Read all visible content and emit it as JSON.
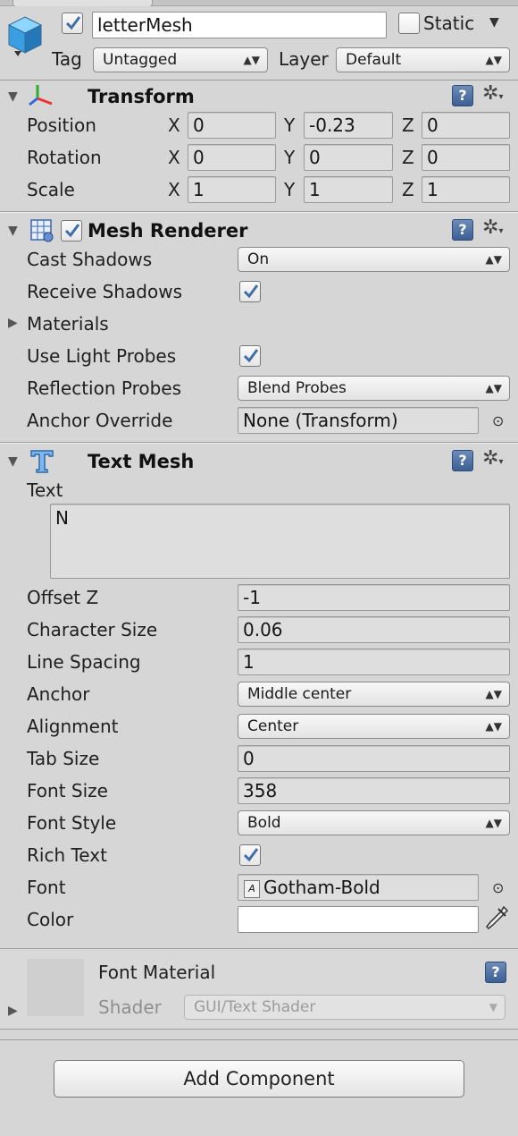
{
  "header": {
    "object_name": "letterMesh",
    "static_label": "Static",
    "tag_label": "Tag",
    "tag_value": "Untagged",
    "layer_label": "Layer",
    "layer_value": "Default"
  },
  "transform": {
    "title": "Transform",
    "position_label": "Position",
    "rotation_label": "Rotation",
    "scale_label": "Scale",
    "axis_x": "X",
    "axis_y": "Y",
    "axis_z": "Z",
    "position": {
      "x": "0",
      "y": "-0.23",
      "z": "0"
    },
    "rotation": {
      "x": "0",
      "y": "0",
      "z": "0"
    },
    "scale": {
      "x": "1",
      "y": "1",
      "z": "1"
    }
  },
  "mesh_renderer": {
    "title": "Mesh Renderer",
    "cast_shadows_label": "Cast Shadows",
    "cast_shadows_value": "On",
    "receive_shadows_label": "Receive Shadows",
    "materials_label": "Materials",
    "use_light_probes_label": "Use Light Probes",
    "reflection_probes_label": "Reflection Probes",
    "reflection_probes_value": "Blend Probes",
    "anchor_override_label": "Anchor Override",
    "anchor_override_value": "None (Transform)"
  },
  "text_mesh": {
    "title": "Text Mesh",
    "text_label": "Text",
    "text_value": "N",
    "offset_z_label": "Offset Z",
    "offset_z_value": "-1",
    "character_size_label": "Character Size",
    "character_size_value": "0.06",
    "line_spacing_label": "Line Spacing",
    "line_spacing_value": "1",
    "anchor_label": "Anchor",
    "anchor_value": "Middle center",
    "alignment_label": "Alignment",
    "alignment_value": "Center",
    "tab_size_label": "Tab Size",
    "tab_size_value": "0",
    "font_size_label": "Font Size",
    "font_size_value": "358",
    "font_style_label": "Font Style",
    "font_style_value": "Bold",
    "rich_text_label": "Rich Text",
    "font_label": "Font",
    "font_value": "Gotham-Bold",
    "color_label": "Color",
    "color_value": "#ffffff"
  },
  "font_material": {
    "title": "Font Material",
    "shader_label": "Shader",
    "shader_value": "GUI/Text Shader"
  },
  "footer": {
    "add_component_label": "Add Component"
  },
  "icons": {
    "object": "cube-icon",
    "transform": "transform-axes-icon",
    "mesh_renderer": "mesh-renderer-icon",
    "text_mesh": "text-mesh-icon",
    "help": "help-book-icon",
    "settings": "gear-icon",
    "object_picker": "object-picker-icon",
    "color_picker": "eyedropper-icon"
  }
}
